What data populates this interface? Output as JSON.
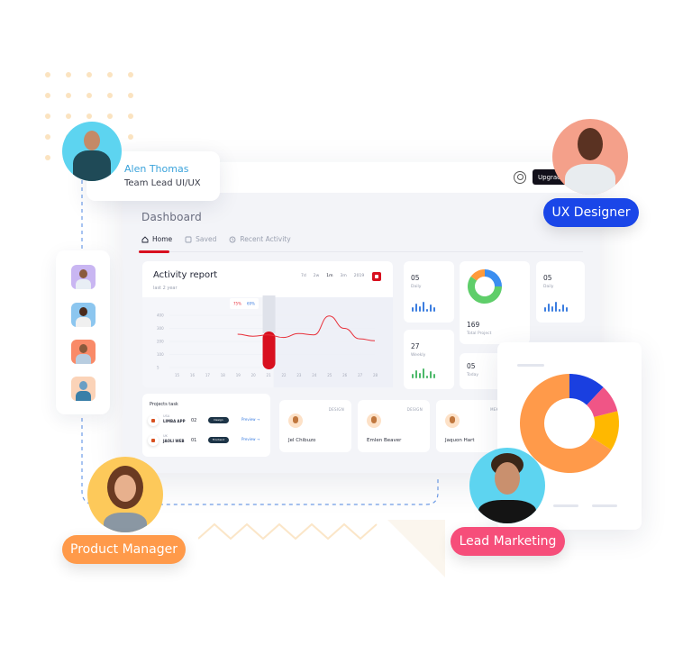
{
  "profile_card": {
    "name": "Alen Thomas",
    "role": "Team Lead UI/UX"
  },
  "dashboard": {
    "title": "Dashboard",
    "topbar": {
      "account_icon": "user-circle-icon",
      "upgrade_label": "Upgrade"
    },
    "tabs": [
      {
        "label": "Home",
        "icon": "home-icon",
        "active": true
      },
      {
        "label": "Saved",
        "icon": "save-icon",
        "active": false
      },
      {
        "label": "Recent Activity",
        "icon": "clock-icon",
        "active": false
      }
    ],
    "activity_report": {
      "title": "Activity report",
      "subtitle": "last 2 year",
      "ranges": [
        "7d",
        "2w",
        "1m",
        "3m",
        "2019"
      ],
      "active_range": "1m",
      "tooltip": {
        "a": "75%",
        "b": "69%"
      },
      "accent": "#d8101f"
    },
    "stats": [
      {
        "value": "05",
        "label": "Daily",
        "bar_color": "#3b7de0"
      },
      {
        "value": "27",
        "label": "Weekly",
        "bar_color": "#4cb96a"
      },
      {
        "value": "169",
        "label": "Total Project"
      },
      {
        "value": "05",
        "label": "Daily",
        "bar_color": "#3b7de0"
      },
      {
        "value": "05",
        "label": "Today"
      }
    ],
    "projects_task": {
      "title": "Projects task",
      "rows": [
        {
          "country": "USA",
          "name": "LIMBA APP",
          "count": "02",
          "badge": "Design",
          "link": "Preview →"
        },
        {
          "country": "UK",
          "name": "JAOLI WEB",
          "count": "01",
          "badge": "Frontend",
          "link": "Preview →"
        }
      ]
    },
    "people": [
      {
        "tag": "DESIGN",
        "name": "Jel Chibuzo"
      },
      {
        "tag": "DESIGN",
        "name": "Emlen Beaver"
      },
      {
        "tag": "MEKT",
        "name": "Jaquon Hart"
      }
    ]
  },
  "chart_data": [
    {
      "type": "line",
      "title": "Activity report",
      "subtitle": "last 2 year",
      "x": [
        "15",
        "16",
        "17",
        "18",
        "19",
        "20",
        "21",
        "22",
        "23",
        "24",
        "25",
        "26",
        "27",
        "28"
      ],
      "yticks": [
        "5",
        "100",
        "200",
        "300",
        "400"
      ],
      "ylim": [
        0,
        400
      ],
      "series": [
        {
          "name": "activity",
          "color": "#e8303a",
          "values": [
            null,
            null,
            null,
            null,
            255,
            240,
            250,
            230,
            260,
            250,
            395,
            300,
            220,
            205
          ]
        }
      ],
      "highlight": {
        "x": "21",
        "value": 75
      },
      "grid": true
    },
    {
      "type": "pie",
      "title": "Total Project",
      "labels": [
        "blue",
        "green",
        "orange"
      ],
      "values": [
        25,
        60,
        15
      ],
      "colors": [
        "#3b8ef0",
        "#5fce6a",
        "#ff9a3a"
      ]
    },
    {
      "type": "pie",
      "title": "",
      "labels": [
        "blue",
        "pink",
        "yellow",
        "orange"
      ],
      "values": [
        12,
        9,
        13,
        66
      ],
      "colors": [
        "#1a3fe0",
        "#f05586",
        "#ffb800",
        "#ff9a4a"
      ]
    }
  ],
  "team_list": [
    "member-1",
    "member-2",
    "member-3",
    "member-4"
  ],
  "roles": {
    "ux_designer": "UX Designer",
    "product_manager": "Product Manager",
    "lead_marketing": "Lead Marketing"
  }
}
